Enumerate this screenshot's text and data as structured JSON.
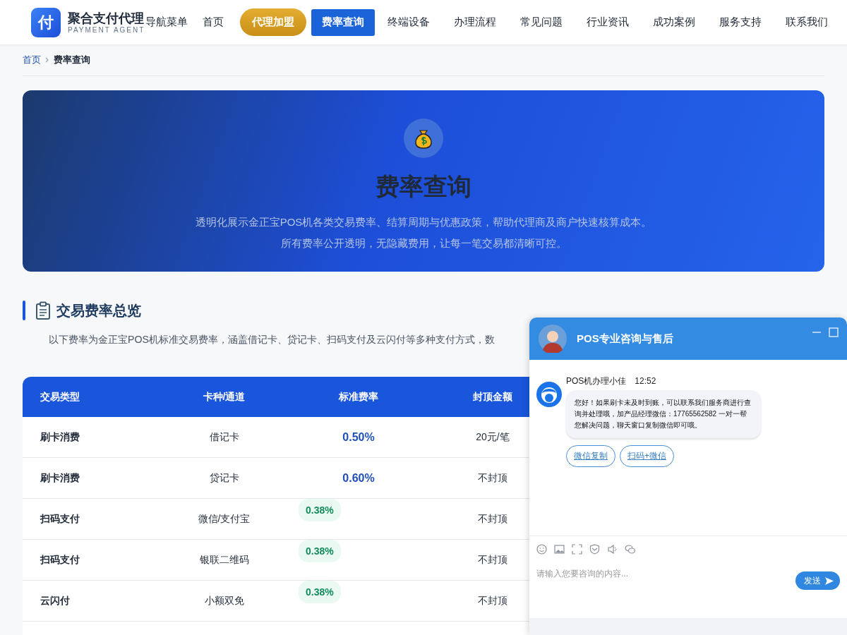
{
  "header": {
    "logo_mark": "付",
    "brand": "聚合支付代理",
    "brand_sub": "PAYMENT AGENT",
    "nav": [
      {
        "label": "导航菜单",
        "kind": "label",
        "selected": false
      },
      {
        "label": "首页",
        "kind": "link",
        "selected": false
      },
      {
        "label": "代理加盟",
        "kind": "cta",
        "selected": false
      },
      {
        "label": "费率查询",
        "kind": "link",
        "selected": true
      },
      {
        "label": "终端设备",
        "kind": "link",
        "selected": false
      },
      {
        "label": "办理流程",
        "kind": "link",
        "selected": false
      },
      {
        "label": "常见问题",
        "kind": "link",
        "selected": false
      },
      {
        "label": "行业资讯",
        "kind": "link",
        "selected": false
      },
      {
        "label": "成功案例",
        "kind": "link",
        "selected": false
      },
      {
        "label": "服务支持",
        "kind": "link",
        "selected": false
      },
      {
        "label": "联系我们",
        "kind": "link",
        "selected": false
      }
    ]
  },
  "breadcrumb": [
    {
      "label": "首页",
      "kind": "link"
    },
    {
      "label": "费率查询",
      "kind": "current"
    }
  ],
  "hero": {
    "title": "费率查询",
    "description": "透明化展示金正宝POS机各类交易费率、结算周期与优惠政策，帮助代理商及商户快速核算成本。所有费率公开透明，无隐藏费用，让每一笔交易都清晰可控。"
  },
  "section": {
    "title": "交易费率总览",
    "description": "以下费率为金正宝POS机标准交易费率，涵盖借记卡、贷记卡、扫码支付及云闪付等多种支付方式，数"
  },
  "table": {
    "columns": [
      "交易类型",
      "卡种/通道",
      "标准费率",
      "封顶金额"
    ],
    "rows": [
      {
        "cells": [
          "刷卡消费",
          "借记卡",
          "0.50%",
          "20元/笔"
        ],
        "kind": "plain"
      },
      {
        "cells": [
          "刷卡消费",
          "贷记卡",
          "0.60%",
          "不封顶"
        ],
        "kind": "plain"
      },
      {
        "cells": [
          "扫码支付",
          "微信/支付宝",
          "0.38%",
          "不封顶"
        ],
        "kind": "badge"
      },
      {
        "cells": [
          "扫码支付",
          "银联二维码",
          "0.38%",
          "不封顶"
        ],
        "kind": "badge"
      },
      {
        "cells": [
          "云闪付",
          "小额双免",
          "0.38%",
          "不封顶"
        ],
        "kind": "badge"
      }
    ]
  },
  "chat": {
    "title": "POS专业咨询与售后",
    "agent": "POS机办理小佳",
    "time": "12:52",
    "message": "您好！如果刷卡未及时到账，可以联系我们服务商进行查询并处理哦，加产品经理微信：17765562582 一对一帮您解决问题，聊天窗口复制微信即可哦。",
    "actions": [
      "微信复制",
      "扫码+微信"
    ],
    "input": {
      "placeholder": "请输入您要咨询的内容..."
    },
    "send": "发送"
  }
}
